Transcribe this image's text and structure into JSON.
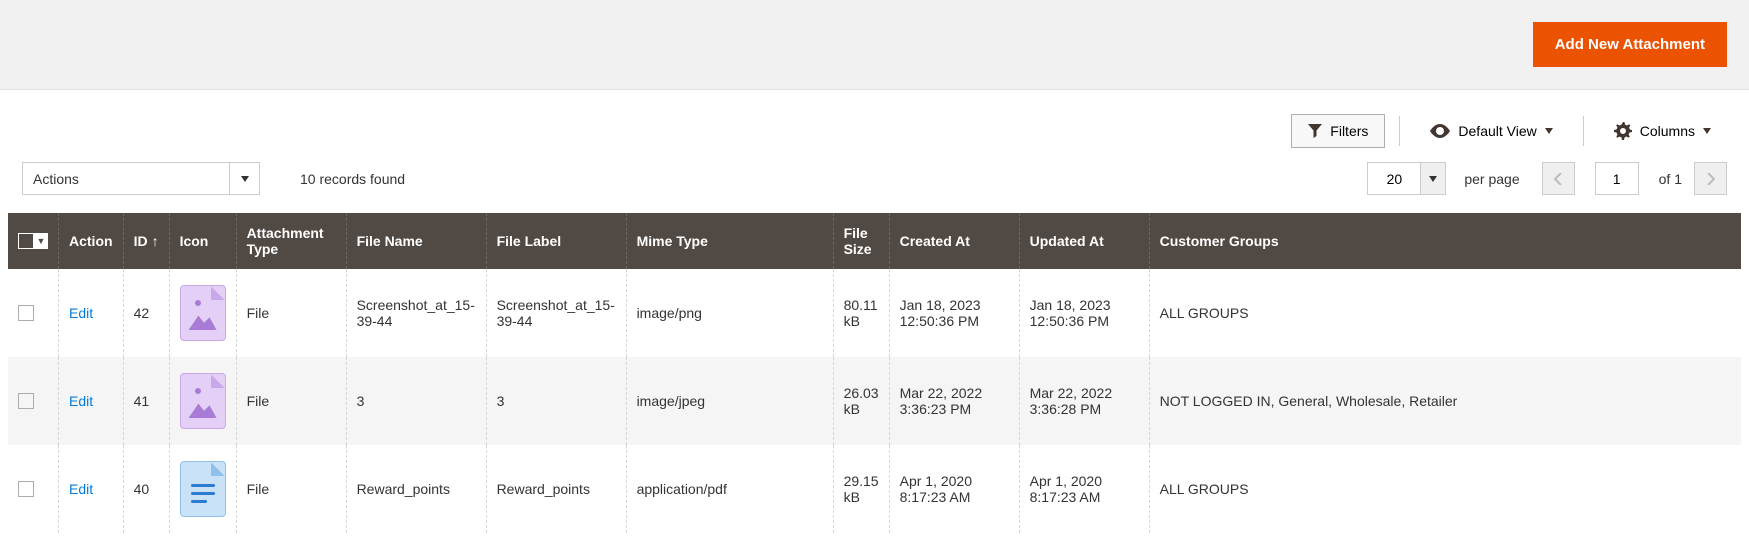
{
  "header": {
    "add_button": "Add New Attachment"
  },
  "toolbar": {
    "filters": "Filters",
    "default_view": "Default View",
    "columns": "Columns"
  },
  "controls": {
    "actions_label": "Actions",
    "records_found": "10 records found",
    "page_size": "20",
    "per_page": "per page",
    "current_page": "1",
    "total_pages_label": "of 1"
  },
  "grid": {
    "headers": {
      "action": "Action",
      "id": "ID",
      "icon": "Icon",
      "type": "Attachment Type",
      "file_name": "File Name",
      "file_label": "File Label",
      "mime": "Mime Type",
      "size": "File Size",
      "created": "Created At",
      "updated": "Updated At",
      "groups": "Customer Groups"
    },
    "rows": [
      {
        "action": "Edit",
        "id": "42",
        "icon": "image",
        "type": "File",
        "file_name": "Screenshot_at_15-39-44",
        "file_label": "Screenshot_at_15-39-44",
        "mime": "image/png",
        "size": "80.11 kB",
        "created": "Jan 18, 2023 12:50:36 PM",
        "updated": "Jan 18, 2023 12:50:36 PM",
        "groups": "ALL GROUPS"
      },
      {
        "action": "Edit",
        "id": "41",
        "icon": "image",
        "type": "File",
        "file_name": "3",
        "file_label": "3",
        "mime": "image/jpeg",
        "size": "26.03 kB",
        "created": "Mar 22, 2022 3:36:23 PM",
        "updated": "Mar 22, 2022 3:36:28 PM",
        "groups": "NOT LOGGED IN, General, Wholesale, Retailer"
      },
      {
        "action": "Edit",
        "id": "40",
        "icon": "doc",
        "type": "File",
        "file_name": "Reward_points",
        "file_label": "Reward_points",
        "mime": "application/pdf",
        "size": "29.15 kB",
        "created": "Apr 1, 2020 8:17:23 AM",
        "updated": "Apr 1, 2020 8:17:23 AM",
        "groups": "ALL GROUPS"
      }
    ]
  }
}
